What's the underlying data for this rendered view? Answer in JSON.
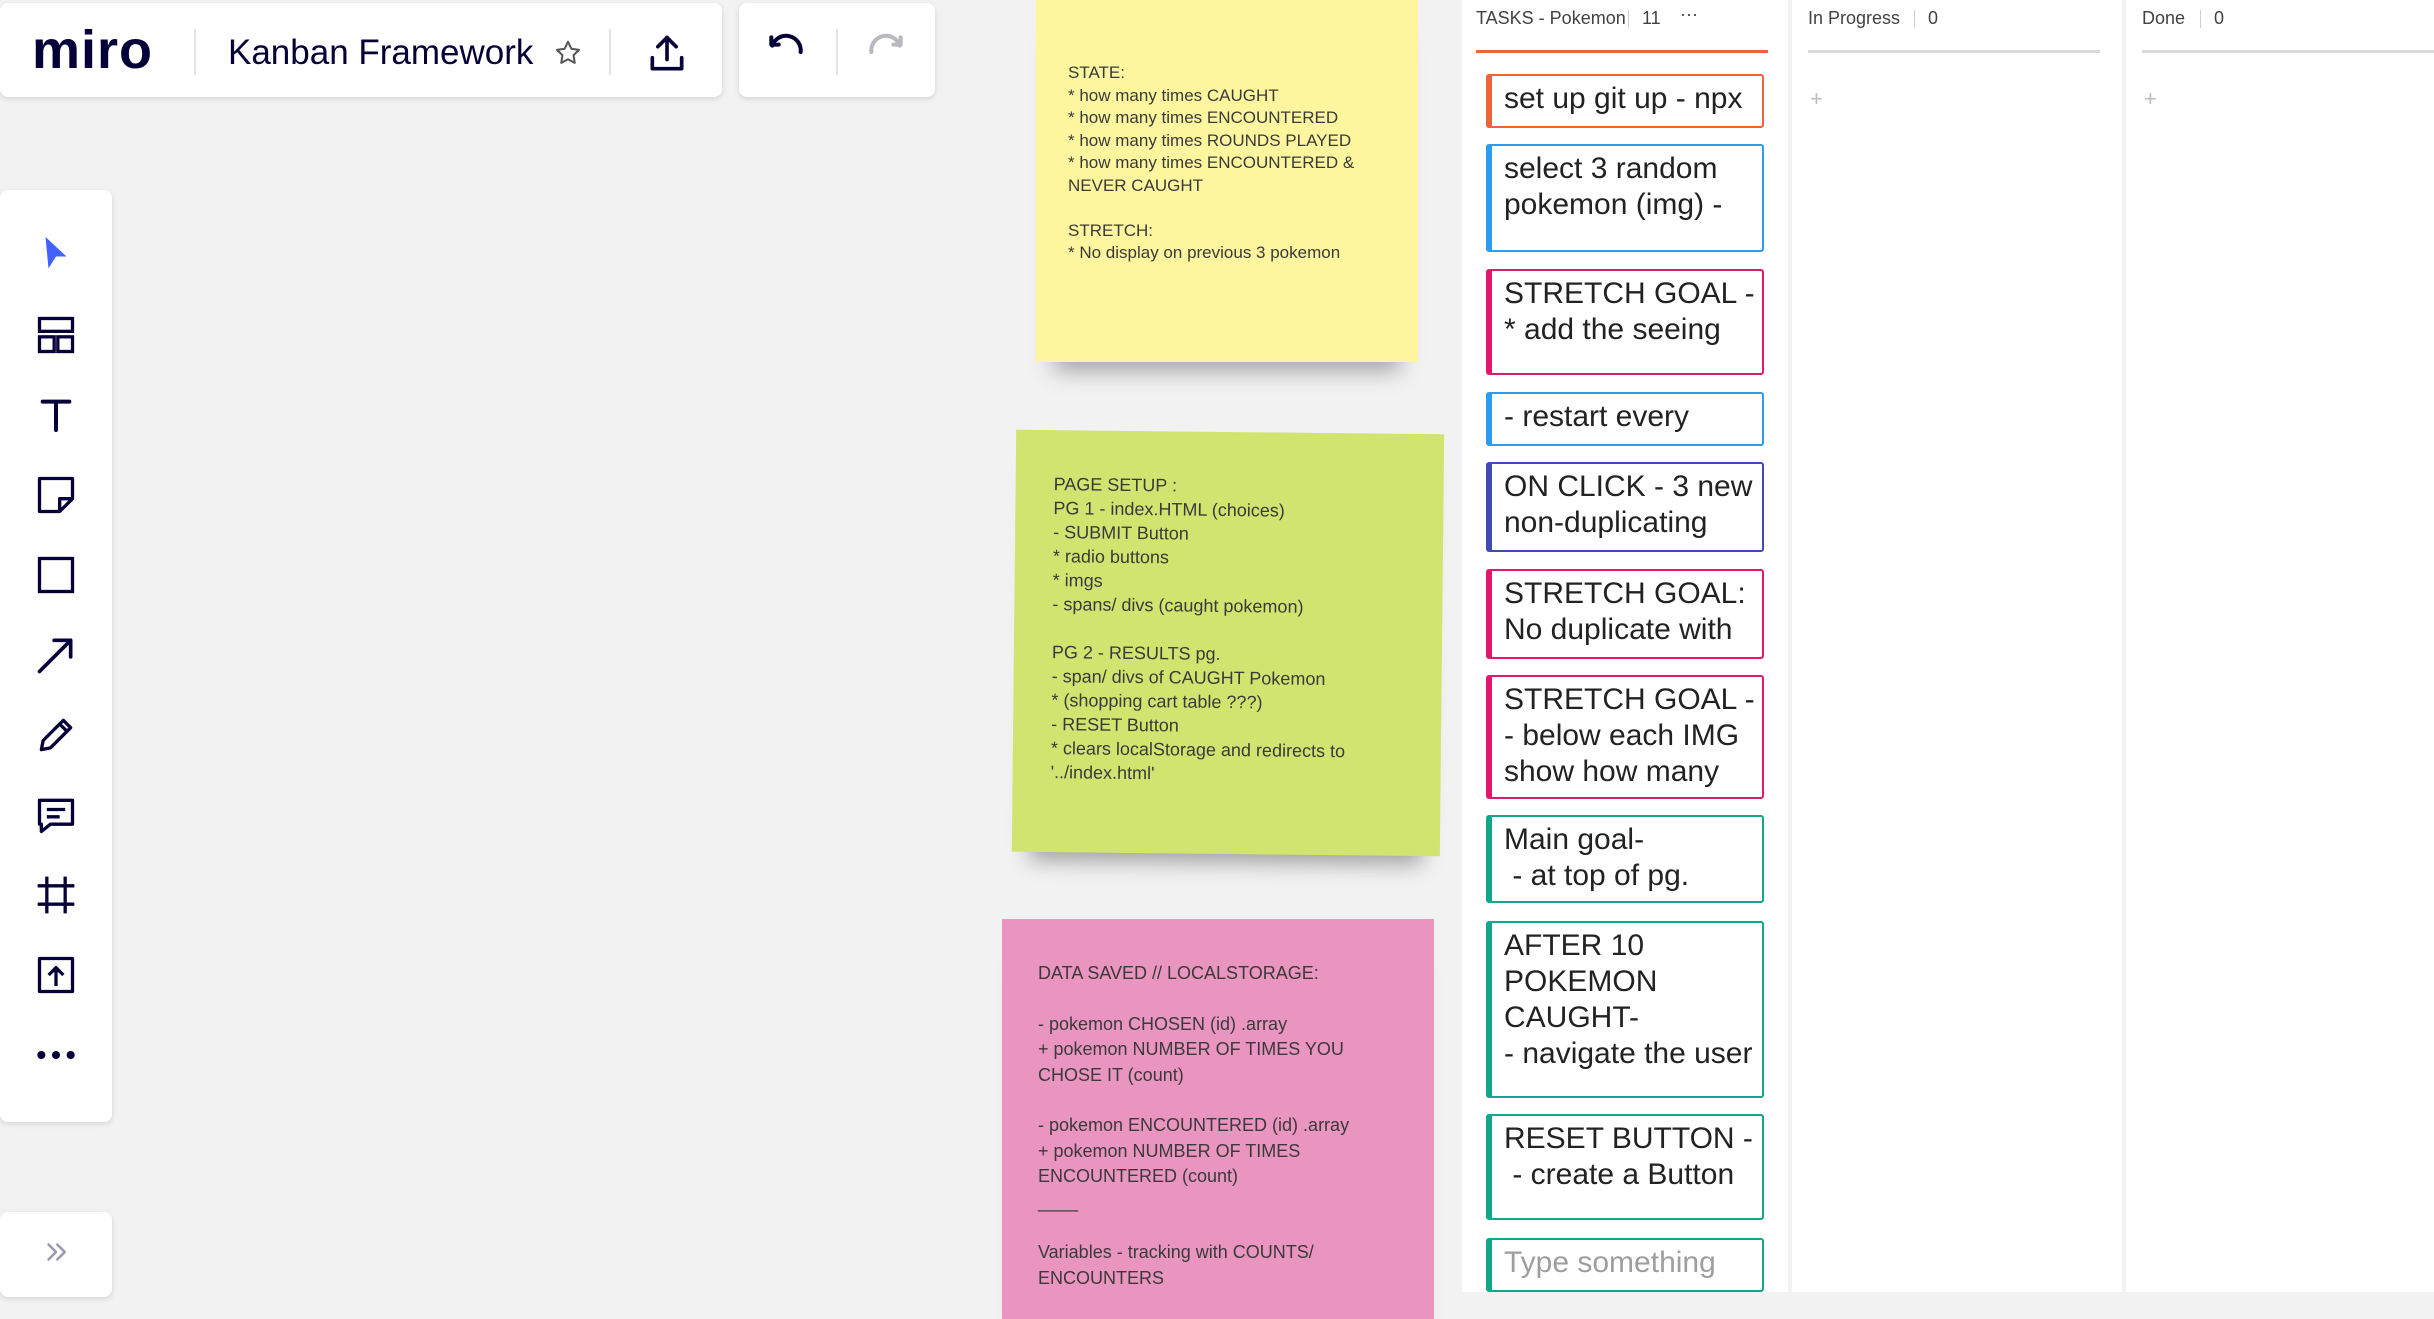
{
  "app": {
    "logo": "miro",
    "board_title": "Kanban Framework"
  },
  "icons": {
    "star": "star-icon",
    "export": "upload-icon",
    "undo": "undo-icon",
    "redo": "redo-icon"
  },
  "toolbar": {
    "tools": [
      "select",
      "templates",
      "text",
      "sticky-note",
      "shape",
      "connection-line",
      "pen",
      "comment",
      "frame",
      "upload",
      "more"
    ]
  },
  "colors": {
    "accent": "#4262ff",
    "yellow_note": "#fef69e",
    "green_note": "#d1e46f",
    "pink_note": "#ea94c0",
    "tasks_line": "#f0623a"
  },
  "stickies": {
    "yellow": "STATE:\n* how many times CAUGHT\n* how many times ENCOUNTERED\n* how many times ROUNDS PLAYED\n* how many times ENCOUNTERED &\nNEVER CAUGHT\n\nSTRETCH:\n* No display on previous 3 pokemon",
    "green": "PAGE SETUP :\nPG 1 - index.HTML (choices)\n- SUBMIT Button\n* radio buttons\n* imgs\n- spans/ divs (caught pokemon)\n\nPG 2 - RESULTS pg.\n- span/ divs of CAUGHT Pokemon\n* (shopping cart table ???)\n- RESET Button\n* clears localStorage and redirects to\n'../index.html'",
    "pink": "DATA SAVED // LOCALSTORAGE:\n\n- pokemon CHOSEN (id) .array\n+ pokemon NUMBER OF TIMES YOU\nCHOSE IT (count)\n\n- pokemon ENCOUNTERED (id) .array\n+ pokemon NUMBER OF TIMES\nENCOUNTERED (count)\n____\n\nVariables - tracking with COUNTS/\nENCOUNTERS"
  },
  "kanban": {
    "columns": [
      {
        "title": "TASKS - Pokemon",
        "count": "11",
        "more": "···"
      },
      {
        "title": "In Progress",
        "count": "0",
        "plus": "+"
      },
      {
        "title": "Done",
        "count": "0",
        "plus": "+"
      }
    ],
    "cards": [
      {
        "text": "set up git up - npx",
        "color": "#f0623a"
      },
      {
        "text": "select 3 random\npokemon (img) -",
        "color": "#2d9bf0"
      },
      {
        "text": "STRETCH GOAL -\n* add the seeing",
        "color": "#e0186e"
      },
      {
        "text": "- restart every",
        "color": "#2d9bf0"
      },
      {
        "text": "ON CLICK - 3 new\nnon-duplicating",
        "color": "#414bb2"
      },
      {
        "text": "STRETCH GOAL:\nNo duplicate with",
        "color": "#e0186e"
      },
      {
        "text": "STRETCH GOAL -\n- below each IMG\nshow how many",
        "color": "#e0186e"
      },
      {
        "text": "Main goal-\n - at top of pg.",
        "color": "#12a68c"
      },
      {
        "text": "AFTER 10\nPOKEMON\nCAUGHT-\n- navigate the user",
        "color": "#12a68c"
      },
      {
        "text": "RESET BUTTON -\n - create a Button",
        "color": "#12a68c"
      }
    ],
    "new_card_placeholder": "Type something"
  }
}
